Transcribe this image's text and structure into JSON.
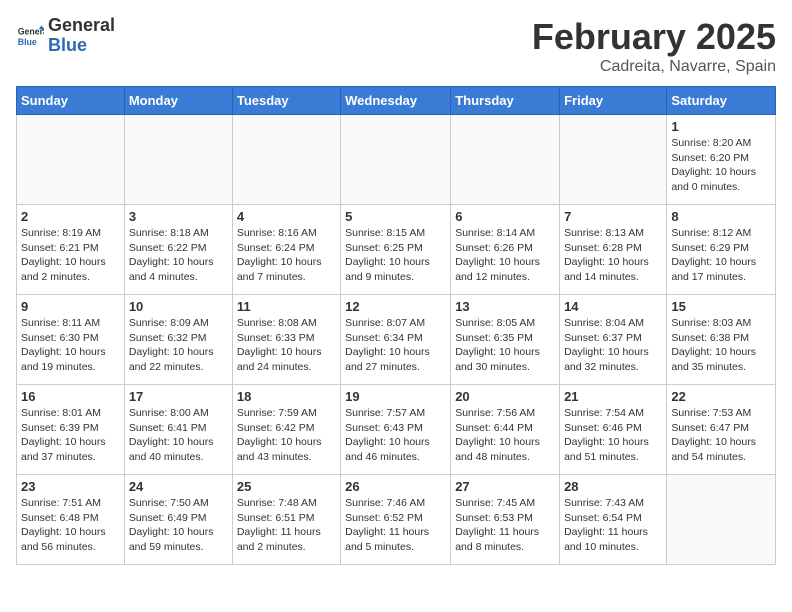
{
  "header": {
    "logo_general": "General",
    "logo_blue": "Blue",
    "month": "February 2025",
    "location": "Cadreita, Navarre, Spain"
  },
  "weekdays": [
    "Sunday",
    "Monday",
    "Tuesday",
    "Wednesday",
    "Thursday",
    "Friday",
    "Saturday"
  ],
  "weeks": [
    [
      {
        "day": "",
        "info": ""
      },
      {
        "day": "",
        "info": ""
      },
      {
        "day": "",
        "info": ""
      },
      {
        "day": "",
        "info": ""
      },
      {
        "day": "",
        "info": ""
      },
      {
        "day": "",
        "info": ""
      },
      {
        "day": "1",
        "info": "Sunrise: 8:20 AM\nSunset: 6:20 PM\nDaylight: 10 hours\nand 0 minutes."
      }
    ],
    [
      {
        "day": "2",
        "info": "Sunrise: 8:19 AM\nSunset: 6:21 PM\nDaylight: 10 hours\nand 2 minutes."
      },
      {
        "day": "3",
        "info": "Sunrise: 8:18 AM\nSunset: 6:22 PM\nDaylight: 10 hours\nand 4 minutes."
      },
      {
        "day": "4",
        "info": "Sunrise: 8:16 AM\nSunset: 6:24 PM\nDaylight: 10 hours\nand 7 minutes."
      },
      {
        "day": "5",
        "info": "Sunrise: 8:15 AM\nSunset: 6:25 PM\nDaylight: 10 hours\nand 9 minutes."
      },
      {
        "day": "6",
        "info": "Sunrise: 8:14 AM\nSunset: 6:26 PM\nDaylight: 10 hours\nand 12 minutes."
      },
      {
        "day": "7",
        "info": "Sunrise: 8:13 AM\nSunset: 6:28 PM\nDaylight: 10 hours\nand 14 minutes."
      },
      {
        "day": "8",
        "info": "Sunrise: 8:12 AM\nSunset: 6:29 PM\nDaylight: 10 hours\nand 17 minutes."
      }
    ],
    [
      {
        "day": "9",
        "info": "Sunrise: 8:11 AM\nSunset: 6:30 PM\nDaylight: 10 hours\nand 19 minutes."
      },
      {
        "day": "10",
        "info": "Sunrise: 8:09 AM\nSunset: 6:32 PM\nDaylight: 10 hours\nand 22 minutes."
      },
      {
        "day": "11",
        "info": "Sunrise: 8:08 AM\nSunset: 6:33 PM\nDaylight: 10 hours\nand 24 minutes."
      },
      {
        "day": "12",
        "info": "Sunrise: 8:07 AM\nSunset: 6:34 PM\nDaylight: 10 hours\nand 27 minutes."
      },
      {
        "day": "13",
        "info": "Sunrise: 8:05 AM\nSunset: 6:35 PM\nDaylight: 10 hours\nand 30 minutes."
      },
      {
        "day": "14",
        "info": "Sunrise: 8:04 AM\nSunset: 6:37 PM\nDaylight: 10 hours\nand 32 minutes."
      },
      {
        "day": "15",
        "info": "Sunrise: 8:03 AM\nSunset: 6:38 PM\nDaylight: 10 hours\nand 35 minutes."
      }
    ],
    [
      {
        "day": "16",
        "info": "Sunrise: 8:01 AM\nSunset: 6:39 PM\nDaylight: 10 hours\nand 37 minutes."
      },
      {
        "day": "17",
        "info": "Sunrise: 8:00 AM\nSunset: 6:41 PM\nDaylight: 10 hours\nand 40 minutes."
      },
      {
        "day": "18",
        "info": "Sunrise: 7:59 AM\nSunset: 6:42 PM\nDaylight: 10 hours\nand 43 minutes."
      },
      {
        "day": "19",
        "info": "Sunrise: 7:57 AM\nSunset: 6:43 PM\nDaylight: 10 hours\nand 46 minutes."
      },
      {
        "day": "20",
        "info": "Sunrise: 7:56 AM\nSunset: 6:44 PM\nDaylight: 10 hours\nand 48 minutes."
      },
      {
        "day": "21",
        "info": "Sunrise: 7:54 AM\nSunset: 6:46 PM\nDaylight: 10 hours\nand 51 minutes."
      },
      {
        "day": "22",
        "info": "Sunrise: 7:53 AM\nSunset: 6:47 PM\nDaylight: 10 hours\nand 54 minutes."
      }
    ],
    [
      {
        "day": "23",
        "info": "Sunrise: 7:51 AM\nSunset: 6:48 PM\nDaylight: 10 hours\nand 56 minutes."
      },
      {
        "day": "24",
        "info": "Sunrise: 7:50 AM\nSunset: 6:49 PM\nDaylight: 10 hours\nand 59 minutes."
      },
      {
        "day": "25",
        "info": "Sunrise: 7:48 AM\nSunset: 6:51 PM\nDaylight: 11 hours\nand 2 minutes."
      },
      {
        "day": "26",
        "info": "Sunrise: 7:46 AM\nSunset: 6:52 PM\nDaylight: 11 hours\nand 5 minutes."
      },
      {
        "day": "27",
        "info": "Sunrise: 7:45 AM\nSunset: 6:53 PM\nDaylight: 11 hours\nand 8 minutes."
      },
      {
        "day": "28",
        "info": "Sunrise: 7:43 AM\nSunset: 6:54 PM\nDaylight: 11 hours\nand 10 minutes."
      },
      {
        "day": "",
        "info": ""
      }
    ]
  ]
}
